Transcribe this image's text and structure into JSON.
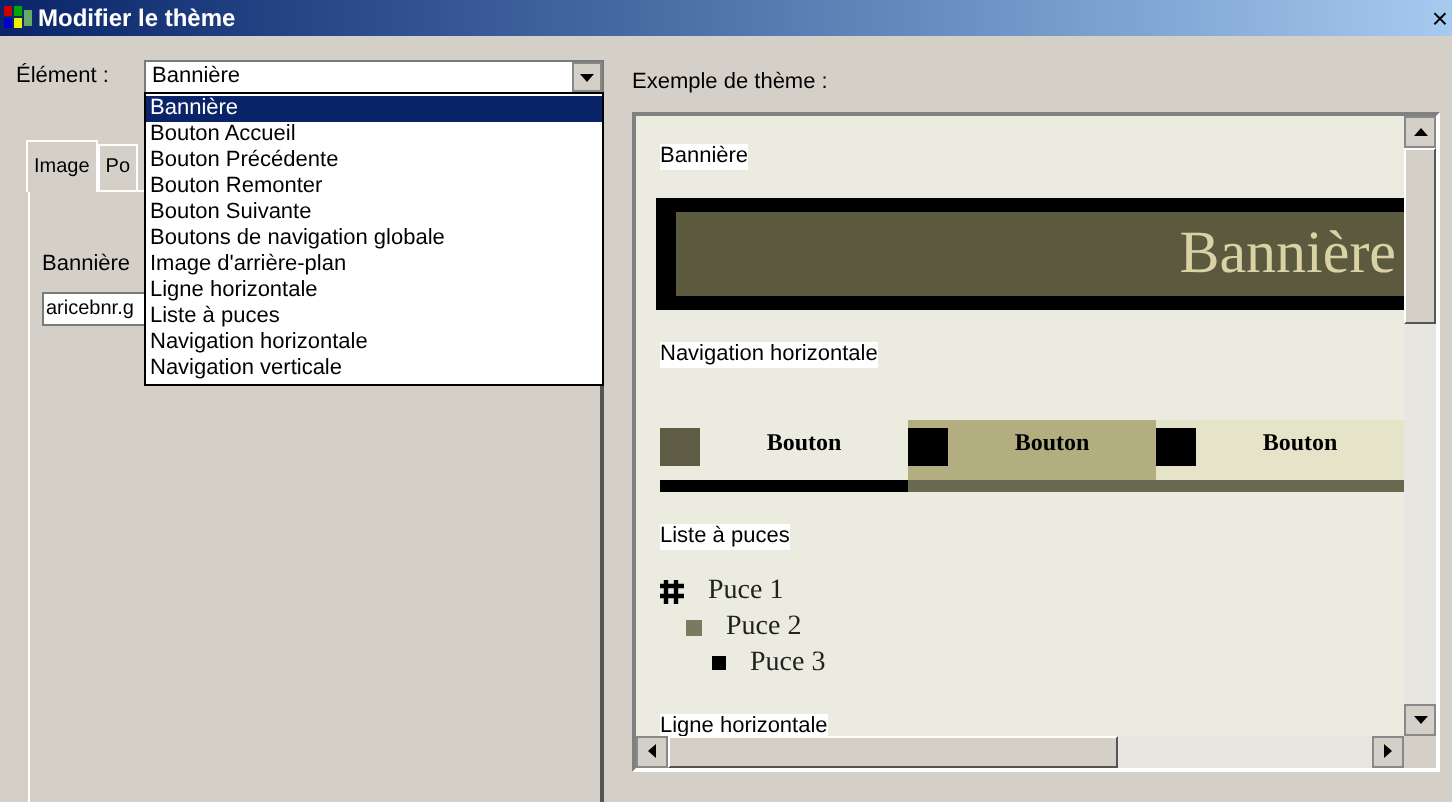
{
  "window": {
    "title": "Modifier le thème",
    "close": "×"
  },
  "element_field": {
    "label": "Élément :",
    "value": "Bannière"
  },
  "dropdown": {
    "items": [
      {
        "label": "Bannière",
        "selected": true
      },
      {
        "label": "Bouton Accueil",
        "selected": false
      },
      {
        "label": "Bouton Précédente",
        "selected": false
      },
      {
        "label": "Bouton Remonter",
        "selected": false
      },
      {
        "label": "Bouton Suivante",
        "selected": false
      },
      {
        "label": "Boutons de navigation globale",
        "selected": false
      },
      {
        "label": "Image d'arrière-plan",
        "selected": false
      },
      {
        "label": "Ligne horizontale",
        "selected": false
      },
      {
        "label": "Liste à puces",
        "selected": false
      },
      {
        "label": "Navigation horizontale",
        "selected": false
      },
      {
        "label": "Navigation verticale",
        "selected": false
      }
    ]
  },
  "tabs": [
    {
      "label": "Image",
      "selected": true
    },
    {
      "label": "Po",
      "selected": false
    }
  ],
  "image_field": {
    "label": "Bannière",
    "value": "aricebnr.g"
  },
  "preview": {
    "label": "Exemple de thème :",
    "sections": [
      {
        "kind": "banner",
        "caption": "Bannière",
        "text": "Bannière"
      },
      {
        "kind": "nav",
        "caption": "Navigation horizontale",
        "buttons": [
          {
            "label": "Bouton",
            "kind": "normal"
          },
          {
            "label": "Bouton",
            "kind": "selected"
          },
          {
            "label": "Bouton",
            "kind": "hover"
          }
        ]
      },
      {
        "kind": "bullets",
        "caption": "Liste à puces",
        "items": [
          {
            "label": "Puce 1",
            "children": [
              {
                "label": "Puce 2",
                "children": [
                  {
                    "label": "Puce 3"
                  }
                ]
              }
            ]
          }
        ]
      },
      {
        "kind": "rule",
        "caption": "Ligne horizontale"
      }
    ]
  }
}
